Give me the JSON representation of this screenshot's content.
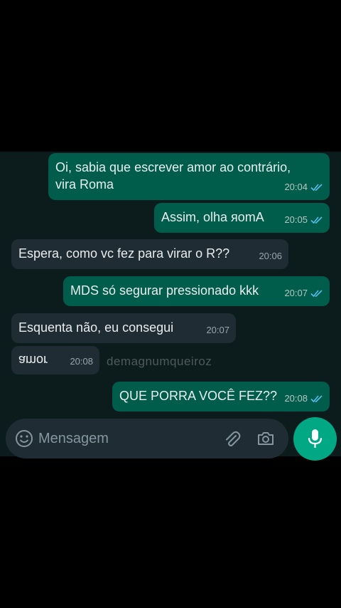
{
  "messages": [
    {
      "direction": "out",
      "text": "Oi, sabia que escrever amor ao contrário,\nvira Roma",
      "time": "20:04",
      "status": "read"
    },
    {
      "direction": "out",
      "text_prefix": "Assim, olha ",
      "text_flipped": "яomA",
      "time": "20:05",
      "status": "read"
    },
    {
      "direction": "in",
      "text": "Espera, como vc fez para virar o R??",
      "time": "20:06"
    },
    {
      "direction": "out",
      "text": "MDS só segurar pressionado kkk",
      "time": "20:07",
      "status": "read"
    },
    {
      "direction": "in",
      "text": "Esquenta não, eu consegui",
      "time": "20:07"
    },
    {
      "direction": "in",
      "text_flipped": "amor",
      "time": "20:08"
    },
    {
      "direction": "out",
      "text": "QUE PORRA VOCÊ FEZ??",
      "time": "20:08",
      "status": "read"
    }
  ],
  "watermark": "demagnumqueiroz",
  "composer": {
    "placeholder": "Mensagem"
  },
  "colors": {
    "outgoing_bubble": "#005c4b",
    "incoming_bubble": "#1f2c33",
    "read_ticks": "#53bdeb",
    "mic_button": "#00a884"
  }
}
